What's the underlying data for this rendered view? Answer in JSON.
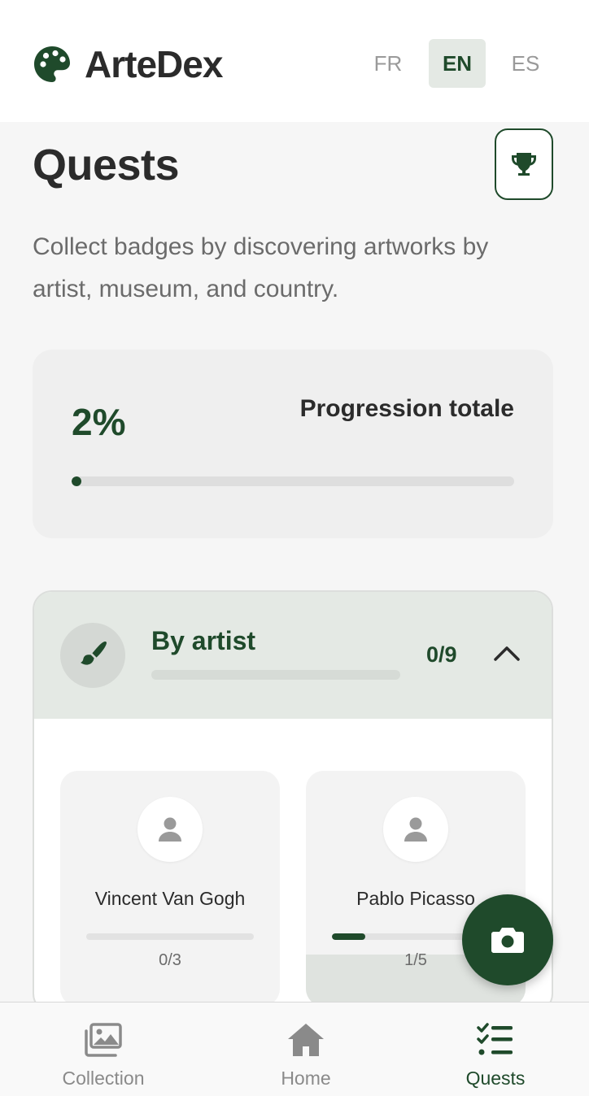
{
  "app": {
    "name": "ArteDex",
    "logo_icon": "palette-icon"
  },
  "languages": [
    {
      "code": "FR",
      "active": false
    },
    {
      "code": "EN",
      "active": true
    },
    {
      "code": "ES",
      "active": false
    }
  ],
  "page": {
    "title": "Quests",
    "trophy_icon": "trophy-icon",
    "subtitle": "Collect badges by discovering artworks by artist, museum, and country."
  },
  "overall_progress": {
    "percent_text": "2%",
    "percent": 2,
    "label": "Progression totale"
  },
  "section": {
    "title": "By artist",
    "icon": "paintbrush-icon",
    "count": "0/9",
    "progress": 0,
    "expanded": true,
    "artists": [
      {
        "name": "Vincent Van Gogh",
        "count": "0/3",
        "progress": 0,
        "icon": "user-icon"
      },
      {
        "name": "Pablo Picasso",
        "count": "1/5",
        "progress": 20,
        "icon": "user-icon"
      }
    ]
  },
  "fab": {
    "icon": "camera-icon"
  },
  "nav": [
    {
      "label": "Collection",
      "icon": "images-icon",
      "active": false
    },
    {
      "label": "Home",
      "icon": "home-icon",
      "active": false
    },
    {
      "label": "Quests",
      "icon": "checklist-icon",
      "active": true
    }
  ],
  "colors": {
    "brand": "#1f4a2b",
    "active_bg": "#e4e9e4",
    "muted_text": "#6b6b6b"
  }
}
